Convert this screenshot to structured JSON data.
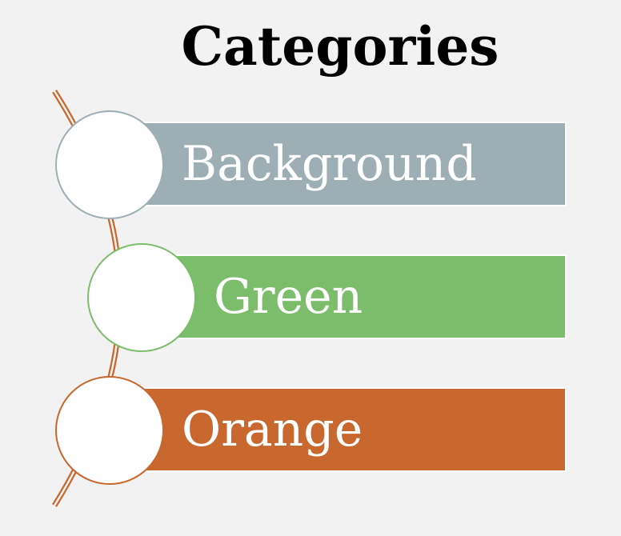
{
  "title": "Categories",
  "items": [
    {
      "label": "Background",
      "color": "#9dafb5",
      "ring_color": "#9dafb5"
    },
    {
      "label": "Green",
      "color": "#7bbd6b",
      "ring_color": "#7bbd6b"
    },
    {
      "label": "Orange",
      "color": "#c8672e",
      "ring_color": "#c8672e"
    }
  ],
  "arc_color": "#c8672e"
}
